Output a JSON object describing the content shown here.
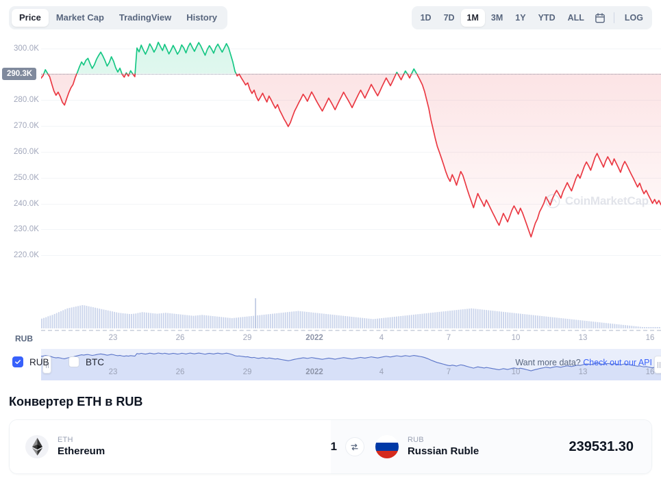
{
  "tabs": {
    "items": [
      {
        "label": "Price",
        "active": true
      },
      {
        "label": "Market Cap",
        "active": false
      },
      {
        "label": "TradingView",
        "active": false
      },
      {
        "label": "History",
        "active": false
      }
    ]
  },
  "ranges": {
    "items": [
      {
        "label": "1D",
        "active": false
      },
      {
        "label": "7D",
        "active": false
      },
      {
        "label": "1M",
        "active": true
      },
      {
        "label": "3M",
        "active": false
      },
      {
        "label": "1Y",
        "active": false
      },
      {
        "label": "YTD",
        "active": false
      },
      {
        "label": "ALL",
        "active": false
      }
    ],
    "calendar_icon": "calendar-icon",
    "log_label": "LOG"
  },
  "chart_data": {
    "type": "line",
    "title": "",
    "xlabel": "",
    "ylabel": "RUB",
    "series_label": "RUB",
    "current_price_label": "290.3K",
    "current_price": 290300,
    "ylim": [
      215000,
      305000
    ],
    "ytick_labels": [
      "300.0K",
      "280.0K",
      "270.0K",
      "260.0K",
      "250.0K",
      "240.0K",
      "230.0K",
      "220.0K"
    ],
    "ytick_values": [
      300000,
      280000,
      270000,
      260000,
      250000,
      240000,
      230000,
      220000
    ],
    "xtick_labels": [
      "23",
      "26",
      "29",
      "2022",
      "4",
      "7",
      "10",
      "13",
      "16"
    ],
    "xtick_bold": [
      false,
      false,
      false,
      true,
      false,
      false,
      false,
      false,
      false
    ],
    "grid": true,
    "legend_position": "bottom-left",
    "color_up": "#16c784",
    "color_down": "#ea3943",
    "reference_color": "#808a9d",
    "volume_color": "#ccd6ec",
    "navigator_color": "#e9eefb",
    "navigator_line_color": "#5a74c8",
    "watermark": "CoinMarketCap",
    "values": [
      288500,
      289600,
      291800,
      290400,
      289100,
      286300,
      283600,
      281900,
      283100,
      281400,
      279200,
      278100,
      280600,
      282900,
      284800,
      286100,
      288700,
      290700,
      292900,
      294800,
      293600,
      295400,
      296200,
      294100,
      292300,
      293700,
      295800,
      297300,
      298600,
      297100,
      295300,
      293200,
      294600,
      296800,
      295100,
      292600,
      290900,
      292400,
      290100,
      288900,
      290600,
      289300,
      291400,
      290200,
      289100,
      300200,
      298700,
      301300,
      299400,
      297800,
      299600,
      301800,
      300400,
      298600,
      300100,
      302400,
      300800,
      299200,
      301600,
      299800,
      297900,
      299400,
      301200,
      299600,
      297800,
      299100,
      301400,
      300200,
      298300,
      300600,
      302100,
      300400,
      298900,
      300700,
      302300,
      300900,
      299100,
      297400,
      299600,
      301100,
      299800,
      298200,
      300400,
      301700,
      300100,
      298600,
      300200,
      301900,
      300300,
      297600,
      294800,
      291200,
      289400,
      290100,
      288600,
      287300,
      285900,
      286700,
      284200,
      282600,
      283900,
      281400,
      279800,
      281200,
      282700,
      280900,
      279300,
      281600,
      280100,
      278400,
      276900,
      278300,
      276100,
      274500,
      272800,
      271400,
      269800,
      271300,
      273600,
      275800,
      277400,
      279100,
      280600,
      282300,
      281100,
      279600,
      281400,
      283200,
      281700,
      280100,
      278600,
      277200,
      275800,
      277400,
      279100,
      280800,
      279400,
      277900,
      276300,
      278100,
      279800,
      281400,
      283100,
      281600,
      280200,
      278700,
      277100,
      278900,
      280600,
      282300,
      283900,
      282400,
      280800,
      282600,
      284300,
      286100,
      284600,
      283100,
      281700,
      283400,
      285200,
      286900,
      288600,
      287100,
      285600,
      287300,
      289100,
      290800,
      289400,
      287900,
      289600,
      291300,
      290100,
      288600,
      290400,
      292100,
      290700,
      289200,
      287600,
      285900,
      283400,
      280100,
      276800,
      272400,
      268900,
      265300,
      262100,
      259800,
      257400,
      254900,
      252300,
      250100,
      248600,
      251200,
      249400,
      247100,
      249800,
      252400,
      250900,
      248300,
      245600,
      243100,
      240800,
      238400,
      241200,
      243900,
      242100,
      240600,
      238900,
      241400,
      239800,
      238100,
      236400,
      234800,
      233100,
      231600,
      233900,
      236200,
      234600,
      232900,
      235100,
      237400,
      239100,
      237600,
      235900,
      238200,
      236400,
      234100,
      231800,
      229400,
      227100,
      229800,
      232400,
      234100,
      236800,
      238400,
      240100,
      242600,
      241100,
      239400,
      241800,
      243600,
      245100,
      243700,
      242100,
      244600,
      246300,
      248100,
      246400,
      244900,
      247200,
      249600,
      251300,
      249800,
      252100,
      254400,
      256100,
      254600,
      252900,
      255300,
      257800,
      259400,
      257600,
      255900,
      254100,
      256400,
      258100,
      256600,
      254900,
      257300,
      255600,
      253900,
      252100,
      254600,
      256300,
      254800,
      253100,
      251400,
      249800,
      248100,
      246400,
      247900,
      245600,
      243800,
      245100,
      243400,
      241800,
      240100,
      241600,
      239900,
      241200,
      239531
    ],
    "volume": [
      42,
      45,
      48,
      52,
      55,
      58,
      62,
      66,
      70,
      74,
      78,
      82,
      86,
      88,
      90,
      92,
      94,
      96,
      98,
      100,
      99,
      97,
      95,
      93,
      91,
      89,
      87,
      85,
      83,
      81,
      79,
      77,
      75,
      73,
      71,
      69,
      67,
      66,
      65,
      64,
      63,
      62,
      62,
      63,
      64,
      66,
      68,
      70,
      69,
      68,
      67,
      66,
      65,
      64,
      63,
      64,
      65,
      66,
      67,
      66,
      65,
      64,
      63,
      62,
      61,
      60,
      59,
      58,
      57,
      56,
      55,
      54,
      55,
      56,
      57,
      58,
      57,
      56,
      55,
      54,
      53,
      52,
      51,
      50,
      49,
      48,
      47,
      46,
      45,
      44,
      45,
      46,
      47,
      48,
      49,
      50,
      51,
      52,
      53,
      54,
      55,
      56,
      57,
      58,
      59,
      60,
      61,
      62,
      63,
      64,
      65,
      66,
      67,
      68,
      69,
      70,
      71,
      72,
      73,
      74,
      75,
      74,
      73,
      72,
      71,
      70,
      69,
      68,
      67,
      66,
      65,
      64,
      63,
      62,
      61,
      60,
      59,
      58,
      57,
      56,
      55,
      54,
      53,
      52,
      51,
      50,
      49,
      48,
      47,
      46,
      45,
      44,
      43,
      42,
      41,
      40,
      41,
      42,
      43,
      44,
      45,
      46,
      47,
      48,
      49,
      50,
      51,
      52,
      53,
      54,
      55,
      56,
      57,
      58,
      59,
      60,
      61,
      62,
      63,
      64,
      65,
      66,
      67,
      68,
      69,
      70,
      71,
      72,
      73,
      74,
      75,
      76,
      77,
      78,
      79,
      80,
      81,
      82,
      83,
      84,
      85,
      86,
      85,
      84,
      83,
      82,
      81,
      80,
      79,
      78,
      77,
      76,
      75,
      74,
      73,
      72,
      71,
      70,
      69,
      68,
      67,
      66,
      65,
      64,
      63,
      62,
      61,
      60,
      59,
      58,
      57,
      56,
      55,
      54,
      53,
      52,
      51,
      50,
      49,
      48,
      47,
      46,
      45,
      44,
      43,
      42,
      41,
      40,
      39,
      38,
      37,
      36,
      35,
      34,
      33,
      32,
      31,
      30,
      29,
      28,
      27,
      26,
      25,
      24,
      23,
      22,
      21,
      20,
      19,
      18,
      17,
      16,
      15,
      14,
      13,
      12,
      11,
      10,
      9,
      8,
      7,
      6,
      5,
      4,
      3,
      2,
      1,
      1,
      1,
      1
    ]
  },
  "legend": {
    "items": [
      {
        "label": "RUB",
        "checked": true
      },
      {
        "label": "BTC",
        "checked": false
      }
    ],
    "api_prefix": "Want more data? ",
    "api_link": "Check out our API"
  },
  "converter": {
    "title": "Конвертер ETH в RUB",
    "from": {
      "symbol": "ETH",
      "name": "Ethereum",
      "icon": "ethereum-icon"
    },
    "amount": "1",
    "swap_icon": "swap-icon",
    "to": {
      "symbol": "RUB",
      "name": "Russian Ruble",
      "icon": "russia-flag-icon"
    },
    "result": "239531.30"
  }
}
